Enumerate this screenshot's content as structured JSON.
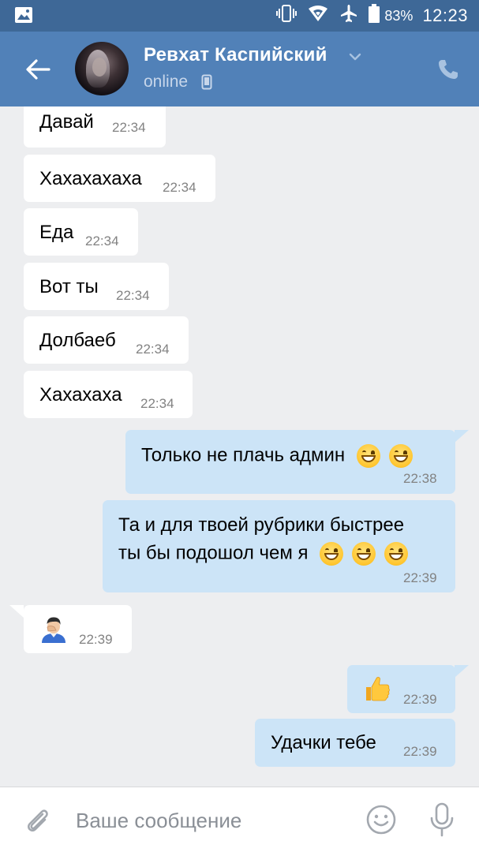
{
  "status_bar": {
    "battery": "83%",
    "time": "12:23"
  },
  "header": {
    "contact_name": "Ревхат Каспийский",
    "status": "online"
  },
  "messages": [
    {
      "direction": "in",
      "text": "Давай",
      "time": "22:34"
    },
    {
      "direction": "in",
      "text": "Хахахахаха",
      "time": "22:34"
    },
    {
      "direction": "in",
      "text": "Еда",
      "time": "22:34"
    },
    {
      "direction": "in",
      "text": "Вот ты",
      "time": "22:34"
    },
    {
      "direction": "in",
      "text": "Долбаеб",
      "time": "22:34"
    },
    {
      "direction": "in",
      "text": "Хахахаха",
      "time": "22:34"
    },
    {
      "direction": "out",
      "text": "Только не плачь админ",
      "emoji": [
        "grinning-face",
        "grinning-face"
      ],
      "time": "22:38"
    },
    {
      "direction": "out",
      "line1": "Та и для твоей рубрики быстрее",
      "line2": "ты бы подошол чем я",
      "emoji": [
        "grinning-face",
        "grinning-face",
        "grinning-face"
      ],
      "time": "22:39"
    },
    {
      "direction": "in",
      "emoji": [
        "face-palm"
      ],
      "time": "22:39"
    },
    {
      "direction": "out",
      "emoji": [
        "thumbs-up"
      ],
      "time": "22:39"
    },
    {
      "direction": "out",
      "text": "Удачки тебе",
      "time": "22:39"
    }
  ],
  "composer": {
    "placeholder": "Ваше сообщение"
  },
  "colors": {
    "header": "#5181b8",
    "status_bar": "#3e6897",
    "background": "#edeef0",
    "incoming_bubble": "#ffffff",
    "outgoing_bubble": "#cce4f7",
    "timestamp": "#828282"
  }
}
